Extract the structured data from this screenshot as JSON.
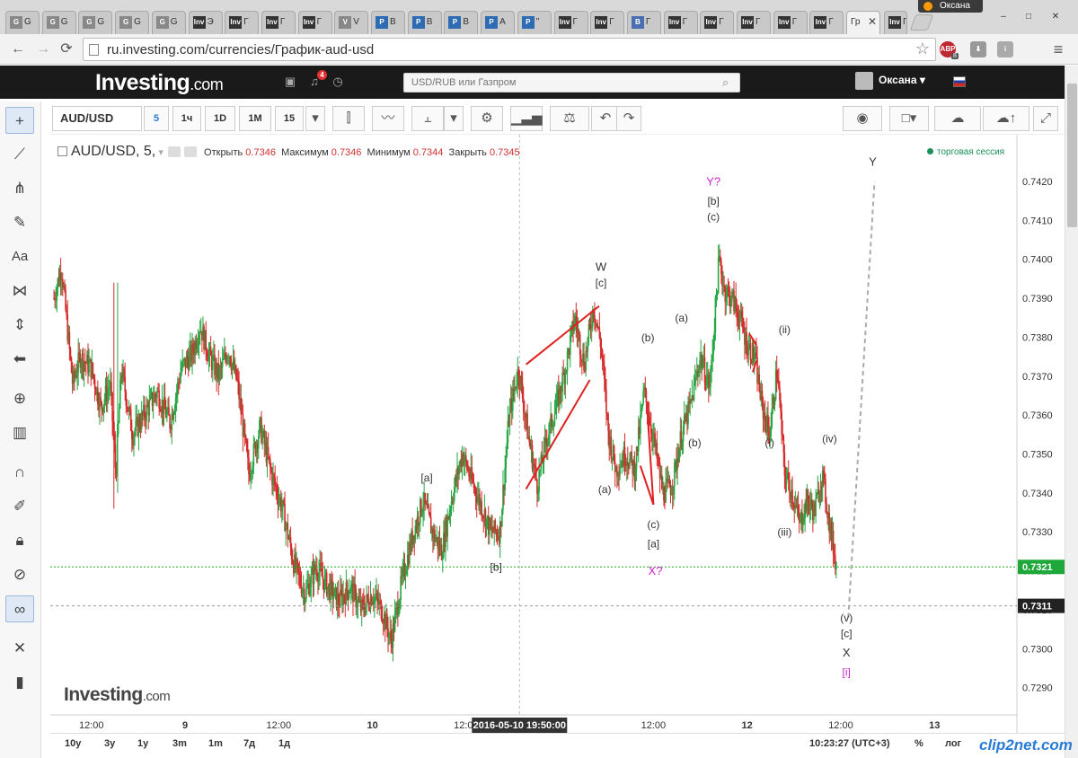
{
  "browser": {
    "tabs": [
      {
        "label": "G",
        "fav": "G",
        "color": "#888888"
      },
      {
        "label": "G",
        "fav": "G",
        "color": "#888888"
      },
      {
        "label": "G",
        "fav": "G",
        "color": "#888888"
      },
      {
        "label": "G",
        "fav": "G",
        "color": "#888888"
      },
      {
        "label": "G",
        "fav": "G",
        "color": "#888888"
      },
      {
        "label": "Э",
        "fav": "Inv",
        "color": "#333333"
      },
      {
        "label": "Г",
        "fav": "Inv",
        "color": "#333333"
      },
      {
        "label": "Г",
        "fav": "Inv",
        "color": "#333333"
      },
      {
        "label": "Г",
        "fav": "Inv",
        "color": "#333333"
      },
      {
        "label": "V",
        "fav": "V",
        "color": "#888888"
      },
      {
        "label": "В",
        "fav": "P",
        "color": "#2d6bb3"
      },
      {
        "label": "В",
        "fav": "P",
        "color": "#2d6bb3"
      },
      {
        "label": "В",
        "fav": "P",
        "color": "#2d6bb3"
      },
      {
        "label": "А",
        "fav": "P",
        "color": "#2d6bb3"
      },
      {
        "label": "\"",
        "fav": "P",
        "color": "#2d6bb3"
      },
      {
        "label": "Г",
        "fav": "Inv",
        "color": "#333333"
      },
      {
        "label": "Г",
        "fav": "Inv",
        "color": "#333333"
      },
      {
        "label": "Г",
        "fav": "B",
        "color": "#4a6fb0"
      },
      {
        "label": "Г",
        "fav": "Inv",
        "color": "#333333"
      },
      {
        "label": "Г",
        "fav": "Inv",
        "color": "#333333"
      },
      {
        "label": "Г",
        "fav": "Inv",
        "color": "#333333"
      },
      {
        "label": "Г",
        "fav": "Inv",
        "color": "#333333"
      },
      {
        "label": "Г",
        "fav": "Inv",
        "color": "#333333"
      }
    ],
    "active_tab": {
      "label": "Гр",
      "close": "✕"
    },
    "profile_name": "Оксана",
    "url": "ru.investing.com/currencies/График-aud-usd",
    "ext_abp": "ABP",
    "ext_abp_count": "8"
  },
  "site": {
    "logo_main": "Investing",
    "logo_tld": ".com",
    "notif_count": "4",
    "search_placeholder": "USD/RUB или Газпром",
    "user_name": "Оксана ▾"
  },
  "toolbar": {
    "symbol": "AUD/USD",
    "intervals": [
      "5",
      "1ч",
      "1D",
      "1M",
      "15"
    ],
    "active_interval": "5"
  },
  "legend": {
    "title": "AUD/USD, 5,",
    "open_label": "Открыть",
    "open": "0.7346",
    "high_label": "Максимум",
    "high": "0.7346",
    "low_label": "Минимум",
    "low": "0.7344",
    "close_label": "Закрыть",
    "close": "0.7345"
  },
  "session_label": "торговая сессия",
  "crosshair_time": "2016-05-10 19:50:00",
  "watermark_main": "Investing",
  "watermark_tld": ".com",
  "range_buttons": [
    "10y",
    "3y",
    "1y",
    "3m",
    "1m",
    "7д",
    "1д"
  ],
  "clock": "10:23:27 (UTC+3)",
  "scale_buttons": [
    "%",
    "лог"
  ],
  "clip2net": "clip2net.com",
  "colors": {
    "up": "#26a644",
    "down": "#d62b2b",
    "annot_red": "#e02020",
    "magenta": "#cc22cc"
  },
  "chart_data": {
    "type": "candlestick",
    "symbol": "AUD/USD",
    "interval": "5",
    "ylim": [
      0.7283,
      0.7432
    ],
    "y_ticks": [
      "0.7420",
      "0.7410",
      "0.7400",
      "0.7390",
      "0.7380",
      "0.7370",
      "0.7360",
      "0.7350",
      "0.7340",
      "0.7330",
      "0.7320",
      "0.7310",
      "0.7300",
      "0.7290"
    ],
    "x_ticks": [
      "12:00",
      "9",
      "12:00",
      "10",
      "12:00",
      "12:00",
      "12",
      "12:00",
      "13"
    ],
    "x_tick_days": [
      0.5,
      1.0,
      1.5,
      2.0,
      2.5,
      3.5,
      4.0,
      4.5,
      5.0
    ],
    "xlim_days": [
      0.295,
      5.44
    ],
    "last_price": "0.7321",
    "dashed_level": "0.7311",
    "price_path": [
      [
        0.3,
        0.739
      ],
      [
        0.34,
        0.7398
      ],
      [
        0.4,
        0.7368
      ],
      [
        0.44,
        0.7375
      ],
      [
        0.5,
        0.7372
      ],
      [
        0.55,
        0.7362
      ],
      [
        0.6,
        0.7368
      ],
      [
        0.63,
        0.7345
      ],
      [
        0.66,
        0.7372
      ],
      [
        0.72,
        0.7355
      ],
      [
        0.78,
        0.736
      ],
      [
        0.85,
        0.7366
      ],
      [
        0.92,
        0.7358
      ],
      [
        0.98,
        0.7372
      ],
      [
        1.04,
        0.7376
      ],
      [
        1.08,
        0.7383
      ],
      [
        1.13,
        0.7375
      ],
      [
        1.18,
        0.737
      ],
      [
        1.23,
        0.7377
      ],
      [
        1.28,
        0.7368
      ],
      [
        1.34,
        0.7345
      ],
      [
        1.4,
        0.7357
      ],
      [
        1.46,
        0.7345
      ],
      [
        1.52,
        0.7336
      ],
      [
        1.58,
        0.7322
      ],
      [
        1.64,
        0.7314
      ],
      [
        1.7,
        0.7321
      ],
      [
        1.76,
        0.7316
      ],
      [
        1.82,
        0.7312
      ],
      [
        1.88,
        0.7316
      ],
      [
        1.94,
        0.731
      ],
      [
        2.0,
        0.7314
      ],
      [
        2.05,
        0.731
      ],
      [
        2.1,
        0.7302
      ],
      [
        2.16,
        0.7318
      ],
      [
        2.22,
        0.733
      ],
      [
        2.27,
        0.7338
      ],
      [
        2.32,
        0.733
      ],
      [
        2.37,
        0.7325
      ],
      [
        2.42,
        0.7338
      ],
      [
        2.48,
        0.735
      ],
      [
        2.53,
        0.7343
      ],
      [
        2.58,
        0.7337
      ],
      [
        2.63,
        0.733
      ],
      [
        2.68,
        0.733
      ],
      [
        2.73,
        0.736
      ],
      [
        2.78,
        0.7372
      ],
      [
        2.83,
        0.7355
      ],
      [
        2.88,
        0.7342
      ],
      [
        2.93,
        0.7354
      ],
      [
        2.98,
        0.7362
      ],
      [
        3.03,
        0.7372
      ],
      [
        3.08,
        0.7385
      ],
      [
        3.13,
        0.7373
      ],
      [
        3.18,
        0.7388
      ],
      [
        3.22,
        0.7378
      ],
      [
        3.26,
        0.7355
      ],
      [
        3.3,
        0.7346
      ],
      [
        3.35,
        0.735
      ],
      [
        3.4,
        0.7346
      ],
      [
        3.45,
        0.7366
      ],
      [
        3.5,
        0.7354
      ],
      [
        3.55,
        0.734
      ],
      [
        3.6,
        0.7342
      ],
      [
        3.65,
        0.7355
      ],
      [
        3.7,
        0.7363
      ],
      [
        3.75,
        0.7375
      ],
      [
        3.8,
        0.7367
      ],
      [
        3.85,
        0.74
      ],
      [
        3.88,
        0.7392
      ],
      [
        3.92,
        0.739
      ],
      [
        3.96,
        0.7385
      ],
      [
        4.0,
        0.7378
      ],
      [
        4.04,
        0.7375
      ],
      [
        4.08,
        0.7362
      ],
      [
        4.12,
        0.7355
      ],
      [
        4.16,
        0.7372
      ],
      [
        4.2,
        0.7345
      ],
      [
        4.24,
        0.734
      ],
      [
        4.28,
        0.7332
      ],
      [
        4.32,
        0.7338
      ],
      [
        4.36,
        0.7335
      ],
      [
        4.4,
        0.7345
      ],
      [
        4.44,
        0.7332
      ],
      [
        4.47,
        0.7323
      ],
      [
        4.48,
        0.7321
      ]
    ],
    "annotations": [
      {
        "text": "W",
        "x": 3.22,
        "y": 0.7397,
        "color": "#333333"
      },
      {
        "text": "[c]",
        "x": 3.22,
        "y": 0.7393,
        "color": "#333333"
      },
      {
        "text": "(b)",
        "x": 3.47,
        "y": 0.7379,
        "color": "#333333"
      },
      {
        "text": "(a)",
        "x": 3.24,
        "y": 0.734,
        "color": "#333333"
      },
      {
        "text": "(c)",
        "x": 3.5,
        "y": 0.7331,
        "color": "#333333"
      },
      {
        "text": "[a]",
        "x": 3.5,
        "y": 0.7326,
        "color": "#333333"
      },
      {
        "text": "X?",
        "x": 3.51,
        "y": 0.7319,
        "color": "#cc22cc"
      },
      {
        "text": "[a]",
        "x": 2.29,
        "y": 0.7343,
        "color": "#333333"
      },
      {
        "text": "[b]",
        "x": 2.66,
        "y": 0.732,
        "color": "#333333"
      },
      {
        "text": "(a)",
        "x": 3.65,
        "y": 0.7384,
        "color": "#333333"
      },
      {
        "text": "(b)",
        "x": 3.72,
        "y": 0.7352,
        "color": "#333333"
      },
      {
        "text": "Y?",
        "x": 3.82,
        "y": 0.7419,
        "color": "#cc22cc"
      },
      {
        "text": "[b]",
        "x": 3.82,
        "y": 0.7414,
        "color": "#333333"
      },
      {
        "text": "(c)",
        "x": 3.82,
        "y": 0.741,
        "color": "#333333"
      },
      {
        "text": "(ii)",
        "x": 4.2,
        "y": 0.7381,
        "color": "#333333"
      },
      {
        "text": "(i)",
        "x": 4.12,
        "y": 0.7352,
        "color": "#333333"
      },
      {
        "text": "(iv)",
        "x": 4.44,
        "y": 0.7353,
        "color": "#333333"
      },
      {
        "text": "(iii)",
        "x": 4.2,
        "y": 0.7329,
        "color": "#333333"
      },
      {
        "text": "(v)",
        "x": 4.53,
        "y": 0.7307,
        "color": "#333333"
      },
      {
        "text": "[c]",
        "x": 4.53,
        "y": 0.7303,
        "color": "#333333"
      },
      {
        "text": "X",
        "x": 4.53,
        "y": 0.7298,
        "color": "#333333"
      },
      {
        "text": "[i]",
        "x": 4.53,
        "y": 0.7293,
        "color": "#cc22cc"
      },
      {
        "text": "Y",
        "x": 4.67,
        "y": 0.7424,
        "color": "#333333"
      }
    ],
    "red_lines": [
      [
        [
          2.82,
          0.7373
        ],
        [
          3.21,
          0.7388
        ]
      ],
      [
        [
          2.82,
          0.7341
        ],
        [
          3.16,
          0.7369
        ]
      ],
      [
        [
          3.43,
          0.7347
        ],
        [
          3.5,
          0.7337
        ]
      ],
      [
        [
          3.47,
          0.7359
        ],
        [
          3.5,
          0.7337
        ]
      ],
      [
        [
          4.01,
          0.7381
        ],
        [
          4.05,
          0.7378
        ]
      ],
      [
        [
          4.03,
          0.7371
        ],
        [
          4.05,
          0.7374
        ]
      ]
    ],
    "projection": [
      [
        4.54,
        0.7308
      ],
      [
        4.68,
        0.742
      ]
    ]
  }
}
